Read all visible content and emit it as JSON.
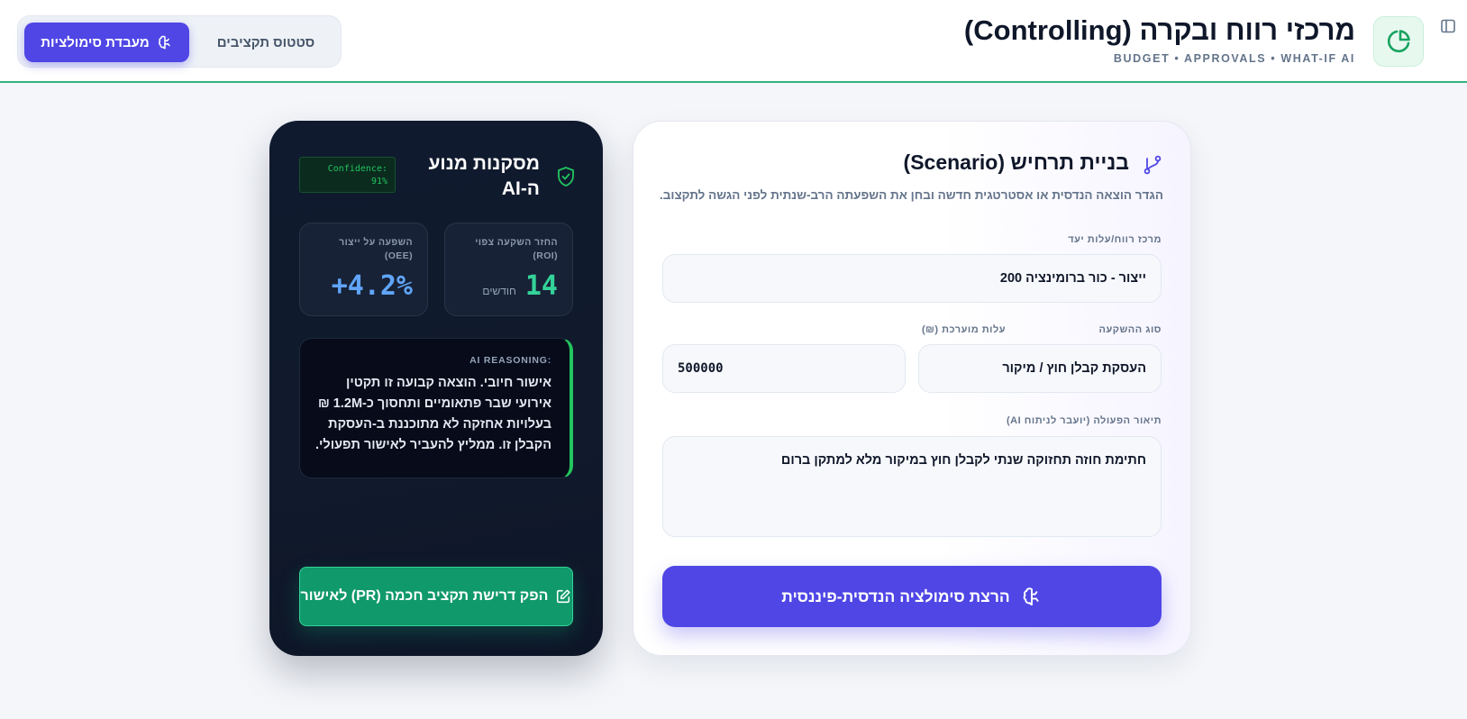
{
  "header": {
    "title": "מרכזי רווח ובקרה (Controlling)",
    "subtitle": "BUDGET • APPROVALS • WHAT-IF AI",
    "brand_icon": "pie-chart-icon",
    "panel_icon": "sidebar-panel-icon"
  },
  "tabs": {
    "active_label": "מעבדת סימולציות",
    "inactive_label": "סטטוס תקציבים"
  },
  "ai_panel": {
    "title": "מסקנות מנוע ה-AI",
    "confidence_label": "Confidence:",
    "confidence_value": "91%",
    "roi_label": "החזר השקעה צפוי (ROI)",
    "roi_value": "14",
    "roi_unit": "חודשים",
    "oee_label": "השפעה על ייצור (OEE)",
    "oee_value": "+4.2%",
    "reasoning_label": "AI REASONING:",
    "reasoning_text": "אישור חיובי. הוצאה קבועה זו תקטין אירועי שבר פתאומיים ותחסוך כ-1.2M ₪ בעלויות אחזקה לא מתוכננת ב-העסקת הקבלן זו. ממליץ להעביר לאישור תפעולי.",
    "pr_button_label": "הפק דרישת תקציב חכמה (PR) לאישור"
  },
  "scenario": {
    "title": "בניית תרחיש (Scenario)",
    "description": "הגדר הוצאה הנדסית או אסטרטגית חדשה ובחן את השפעתה הרב-שנתית לפני הגשה לתקצוב.",
    "target_label": "מרכז רווח/עלות יעד",
    "target_value": "ייצור - כור ברומינציה 200",
    "investment_type_label": "סוג ההשקעה",
    "investment_type_value": "העסקת קבלן חוץ / מיקור",
    "cost_label": "עלות מוערכת (₪)",
    "cost_value": "500000",
    "action_label": "תיאור הפעולה (יועבר לניתוח AI)",
    "action_value": "חתימת חוזה תחזוקה שנתי לקבלן חוץ במיקור מלא למתקן ברום",
    "run_button_label": "הרצת סימולציה הנדסית-פיננסית"
  },
  "colors": {
    "accent": "#4f46e5",
    "success": "#10996a",
    "roi": "#34d399",
    "oee": "#60a5fa",
    "dark_card": "#0f1a2e"
  }
}
